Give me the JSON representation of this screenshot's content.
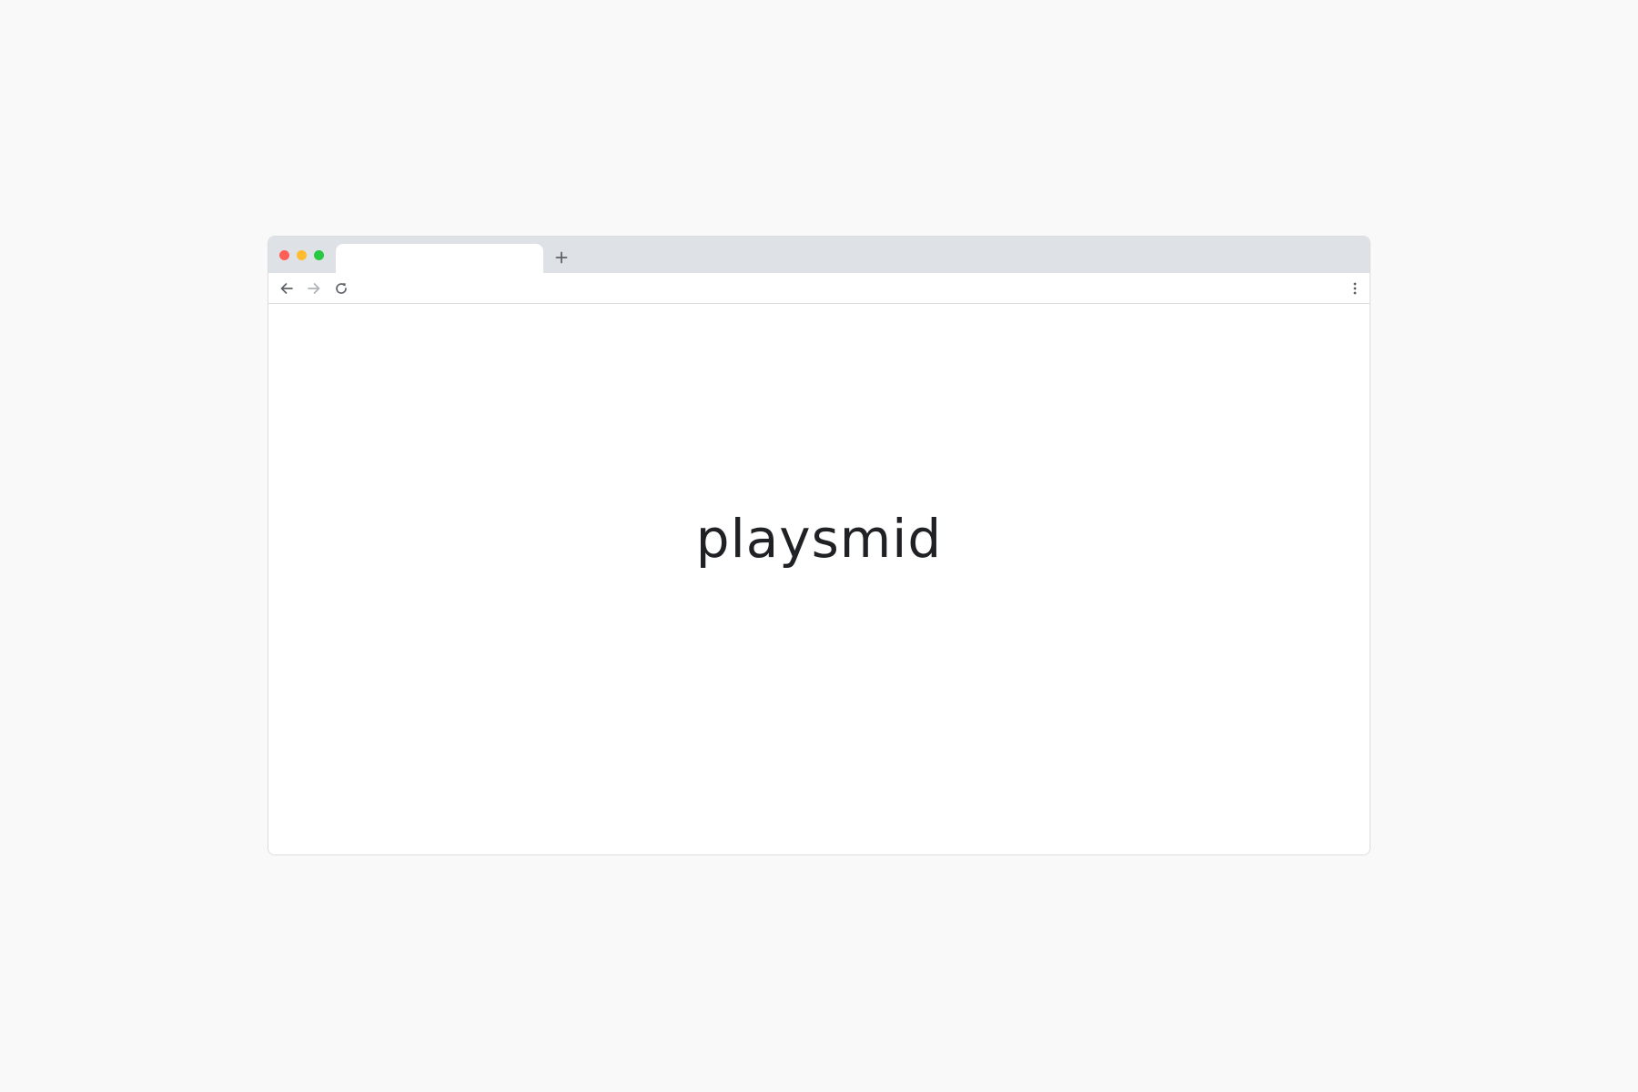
{
  "window": {
    "traffic_lights": {
      "close_color": "#ff5f57",
      "minimize_color": "#febc2e",
      "maximize_color": "#28c840"
    }
  },
  "tab_strip": {
    "active_tab": {
      "title": ""
    },
    "new_tab_icon": "plus-icon"
  },
  "toolbar": {
    "back_icon": "arrow-left-icon",
    "forward_icon": "arrow-right-icon",
    "forward_enabled": false,
    "reload_icon": "reload-icon",
    "menu_icon": "vertical-dots-icon"
  },
  "page": {
    "brand_text": "playsmid",
    "text_color": "#202124"
  }
}
